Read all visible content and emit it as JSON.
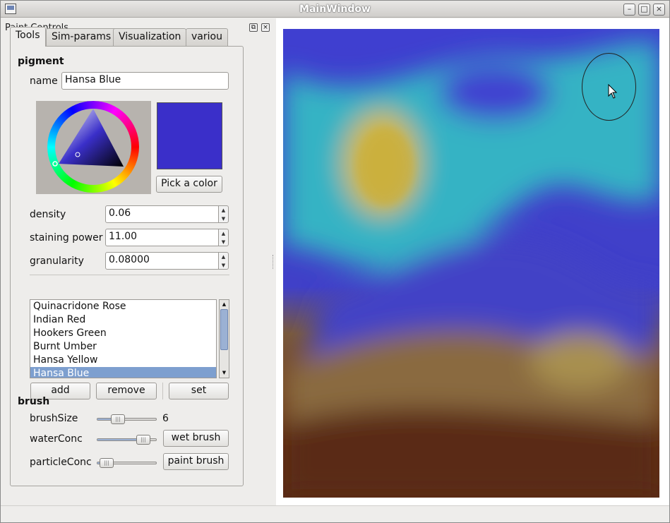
{
  "window": {
    "title": "MainWindow",
    "minimize": "–",
    "maximize": "□",
    "close": "×"
  },
  "dock": {
    "title": "Paint Controls",
    "float": "⧉",
    "close": "×"
  },
  "tabs": [
    {
      "label": "Tools"
    },
    {
      "label": "Sim-params"
    },
    {
      "label": "Visualization"
    },
    {
      "label": "variou"
    }
  ],
  "pigment": {
    "section": "pigment",
    "name_label": "name",
    "name_value": "Hansa Blue",
    "swatch_color": "#3a2fc9",
    "pick_button": "Pick a color",
    "density_label": "density",
    "density_value": "0.06",
    "staining_label": "staining power",
    "staining_value": "11.00",
    "granularity_label": "granularity",
    "granularity_value": "0.08000",
    "list": [
      "Quinacridone Rose",
      "Indian Red",
      "Hookers Green",
      "Burnt Umber",
      "Hansa Yellow",
      "Hansa Blue"
    ],
    "selected_index": 5,
    "add_button": "add",
    "remove_button": "remove",
    "set_button": "set"
  },
  "brush": {
    "section": "brush",
    "size_label": "brushSize",
    "size_value": "6",
    "size_level": 0.3,
    "water_label": "waterConc",
    "water_level": 0.88,
    "particle_label": "particleConc",
    "particle_level": 0.05,
    "wet_button": "wet brush",
    "paint_button": "paint brush"
  },
  "colors": {
    "accent": "#7d9fcf",
    "canvas_blue": "#3f3fd0",
    "canvas_cyan": "#35b3c4",
    "canvas_yellow": "#d2b840",
    "canvas_brown": "#5a2b12"
  },
  "icons": {
    "cursor": "arrow-cursor-icon",
    "brush_outline": "brush-circle-icon"
  }
}
